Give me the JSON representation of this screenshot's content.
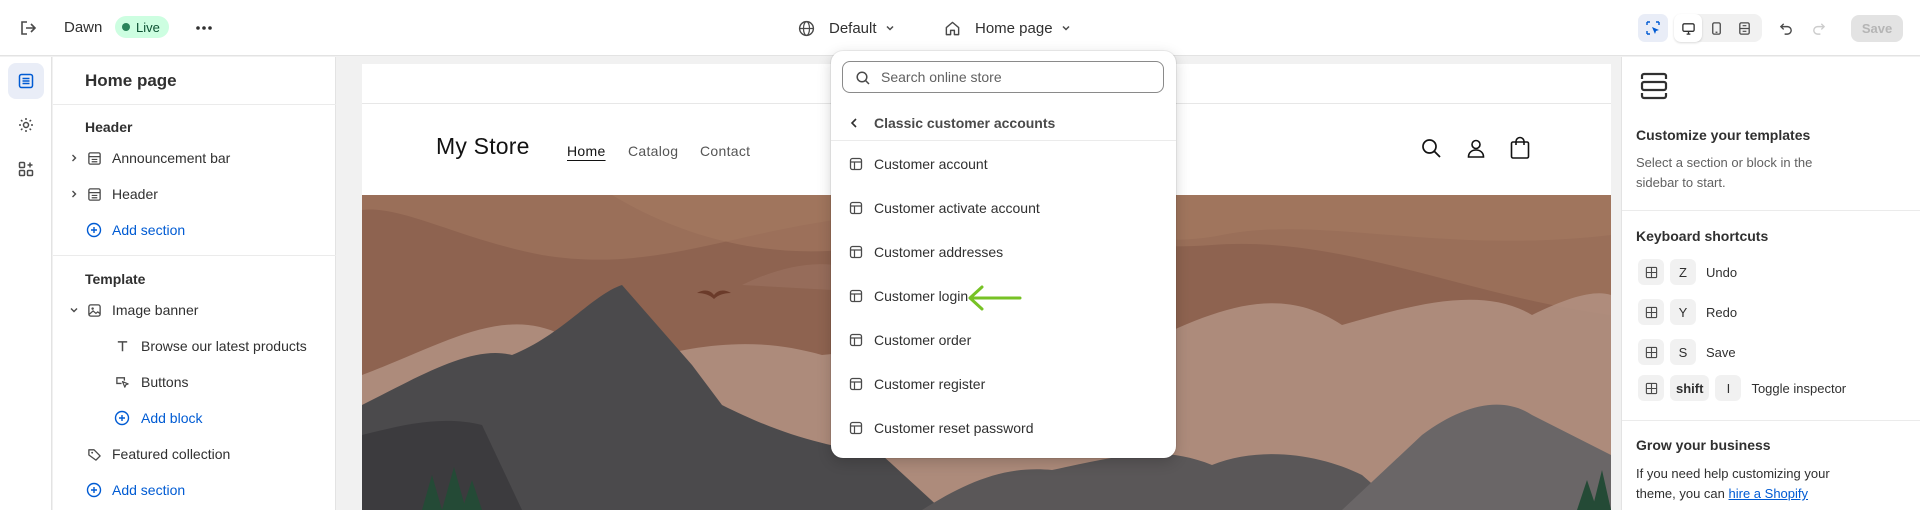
{
  "topbar": {
    "theme_name": "Dawn",
    "status": "Live",
    "locale": "Default",
    "page": "Home page",
    "save_label": "Save"
  },
  "sidebar": {
    "title": "Home page",
    "header_group": "Header",
    "header_items": [
      "Announcement bar",
      "Header"
    ],
    "add_section": "Add section",
    "template_group": "Template",
    "template_section": "Image banner",
    "blocks": [
      "Browse our latest products",
      "Buttons"
    ],
    "add_block": "Add block",
    "featured": "Featured collection",
    "add_section_2": "Add section"
  },
  "preview": {
    "store_name": "My Store",
    "nav": [
      "Home",
      "Catalog",
      "Contact"
    ]
  },
  "dropdown": {
    "search_placeholder": "Search online store",
    "back_label": "Classic customer accounts",
    "items": [
      "Customer account",
      "Customer activate account",
      "Customer addresses",
      "Customer login",
      "Customer order",
      "Customer register",
      "Customer reset password"
    ],
    "annotation_color": "#77c225"
  },
  "rpanel": {
    "title": "Customize your templates",
    "desc_line1": "Select a section or block in the",
    "desc_line2": "sidebar to start.",
    "shortcuts_title": "Keyboard shortcuts",
    "shortcuts": [
      {
        "key": "Z",
        "label": "Undo"
      },
      {
        "key": "Y",
        "label": "Redo"
      },
      {
        "key": "S",
        "label": "Save"
      }
    ],
    "inspector": {
      "mod": "shift",
      "key": "I",
      "label": "Toggle inspector"
    },
    "grow_title": "Grow your business",
    "grow_line1": "If you need help customizing your",
    "grow_line2": "theme, you can",
    "grow_link": "hire a Shopify"
  },
  "colors": {
    "accent": "#005bd3",
    "live_bg": "#cdfee1",
    "live_dot": "#29845a"
  }
}
